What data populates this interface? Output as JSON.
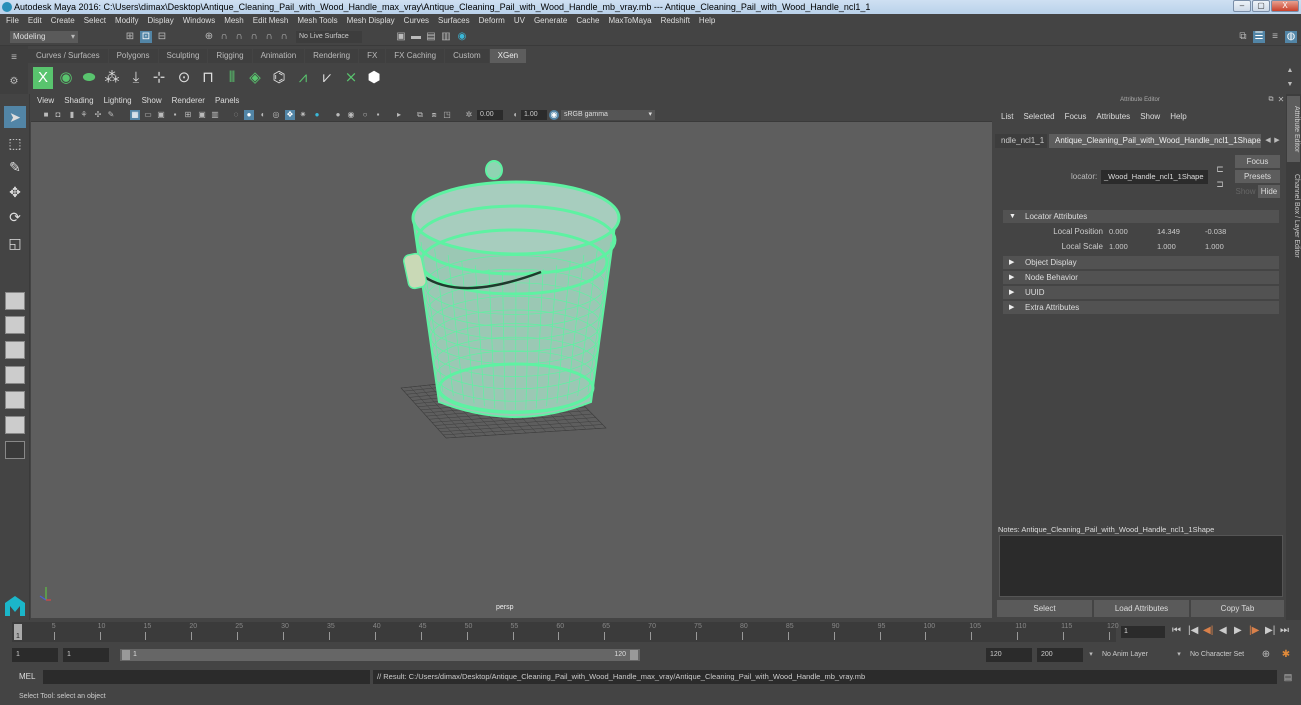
{
  "window": {
    "title": "Autodesk Maya 2016: C:\\Users\\dimax\\Desktop\\Antique_Cleaning_Pail_with_Wood_Handle_max_vray\\Antique_Cleaning_Pail_with_Wood_Handle_mb_vray.mb   ---   Antique_Cleaning_Pail_with_Wood_Handle_ncl1_1",
    "minimize": "–",
    "maximize": "▢",
    "close": "X"
  },
  "menubar": [
    "File",
    "Edit",
    "Create",
    "Select",
    "Modify",
    "Display",
    "Windows",
    "Mesh",
    "Edit Mesh",
    "Mesh Tools",
    "Mesh Display",
    "Curves",
    "Surfaces",
    "Deform",
    "UV",
    "Generate",
    "Cache",
    "MaxToMaya",
    "Redshift",
    "Help"
  ],
  "statusline": {
    "mode": "Modeling",
    "live_surface": "No Live Surface"
  },
  "shelf": {
    "tabs": [
      "Curves / Surfaces",
      "Polygons",
      "Sculpting",
      "Rigging",
      "Animation",
      "Rendering",
      "FX",
      "FX Caching",
      "Custom",
      "XGen"
    ],
    "selected_tab": "XGen",
    "icons": [
      "xgen-create-icon",
      "xgen-eye-icon",
      "xgen-leaf-icon",
      "xgen-add-primitives-icon",
      "xgen-place-icon",
      "xgen-add-guide-icon",
      "xgen-visibility-icon",
      "xgen-lock-icon",
      "xgen-guides-icon",
      "xgen-layer-icon",
      "xgen-sculpt-icon",
      "xgen-select-guides-icon",
      "xgen-flatten-icon",
      "xgen-delete-icon",
      "xgen-logo-icon"
    ]
  },
  "viewport": {
    "menu": [
      "View",
      "Shading",
      "Lighting",
      "Show",
      "Renderer",
      "Panels"
    ],
    "exposure": "0.00",
    "gamma": "1.00",
    "color_management": "sRGB gamma",
    "camera_label": "persp",
    "wire_color": "#5ef2a2"
  },
  "attribute_editor": {
    "title": "Attribute Editor",
    "menu": [
      "List",
      "Selected",
      "Focus",
      "Attributes",
      "Show",
      "Help"
    ],
    "tabs": [
      "ndle_ncl1_1",
      "Antique_Cleaning_Pail_with_Wood_Handle_ncl1_1Shape"
    ],
    "selected_tab": 1,
    "node_type_label": "locator:",
    "node_name": "_Wood_Handle_ncl1_1Shape",
    "buttons": {
      "focus": "Focus",
      "presets": "Presets",
      "show": "Show",
      "hide": "Hide"
    },
    "sections": [
      {
        "label": "Locator Attributes",
        "expanded": true
      },
      {
        "label": "Object Display",
        "expanded": false
      },
      {
        "label": "Node Behavior",
        "expanded": false
      },
      {
        "label": "UUID",
        "expanded": false
      },
      {
        "label": "Extra Attributes",
        "expanded": false
      }
    ],
    "attributes": [
      {
        "label": "Local Position",
        "values": [
          "0.000",
          "14.349",
          "-0.038"
        ]
      },
      {
        "label": "Local Scale",
        "values": [
          "1.000",
          "1.000",
          "1.000"
        ]
      }
    ],
    "notes_label": "Notes:  Antique_Cleaning_Pail_with_Wood_Handle_ncl1_1Shape",
    "bottom_buttons": [
      "Select",
      "Load Attributes",
      "Copy Tab"
    ]
  },
  "side_tabs": [
    "Attribute Editor",
    "Channel Box / Layer Editor"
  ],
  "timeline": {
    "ticks": [
      "5",
      "10",
      "15",
      "20",
      "25",
      "30",
      "35",
      "40",
      "45",
      "50",
      "55",
      "60",
      "65",
      "70",
      "75",
      "80",
      "85",
      "90",
      "95",
      "100",
      "105",
      "110",
      "115",
      "120"
    ],
    "start_marker": "1",
    "current_frame": "1",
    "playback": [
      "⏮",
      "|◀",
      "◀|",
      "◀",
      "▶",
      "|▶",
      "▶|",
      "⏭"
    ]
  },
  "range": {
    "start": "1",
    "playback_start": "1",
    "slider_start": "1",
    "slider_end": "120",
    "playback_end": "120",
    "end": "200",
    "anim_layer": "No Anim Layer",
    "character_set": "No Character Set"
  },
  "command": {
    "language": "MEL",
    "input": "",
    "result": "// Result: C:/Users/dimax/Desktop/Antique_Cleaning_Pail_with_Wood_Handle_max_vray/Antique_Cleaning_Pail_with_Wood_Handle_mb_vray.mb"
  },
  "help_line": "Select Tool: select an object"
}
